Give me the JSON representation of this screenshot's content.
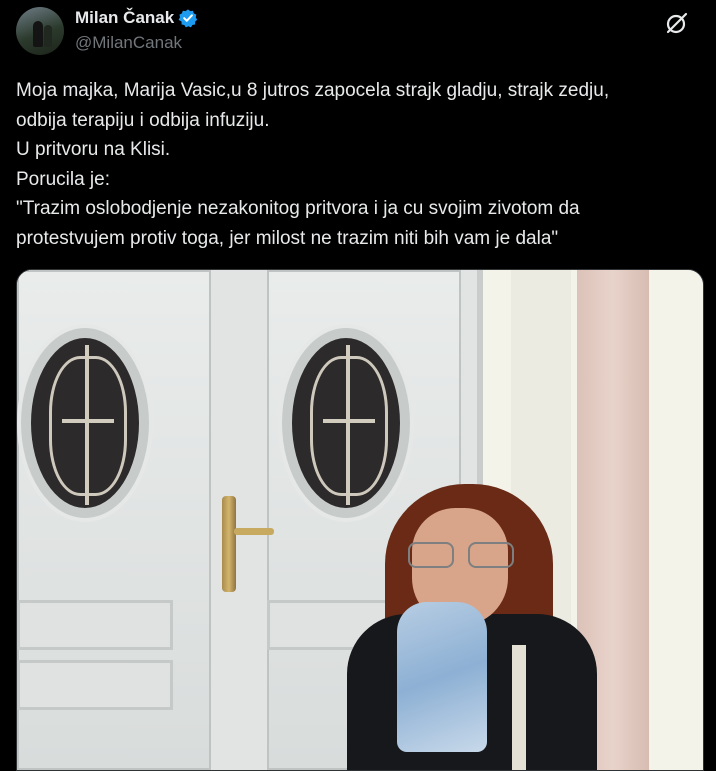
{
  "author": {
    "display_name": "Milan Čanak",
    "handle": "@MilanCanak",
    "verified": true
  },
  "icons": {
    "verified": "verified-badge-icon",
    "grok": "grok-icon"
  },
  "colors": {
    "background": "#000000",
    "text": "#e7e9ea",
    "muted": "#71767b",
    "verified": "#1d9bf0"
  },
  "tweet": {
    "lines": [
      "Moja majka, Marija Vasic,u 8 jutros zapocela strajk gladju, strajk zedju,",
      "odbija terapiju i odbija infuziju.",
      "U pritvoru na Klisi.",
      "Porucila je:",
      "\"Trazim oslobodjenje nezakonitog pritvora i ja cu svojim zivotom da",
      "protestvujem protiv toga, jer milost ne trazim niti bih vam je dala\""
    ]
  }
}
